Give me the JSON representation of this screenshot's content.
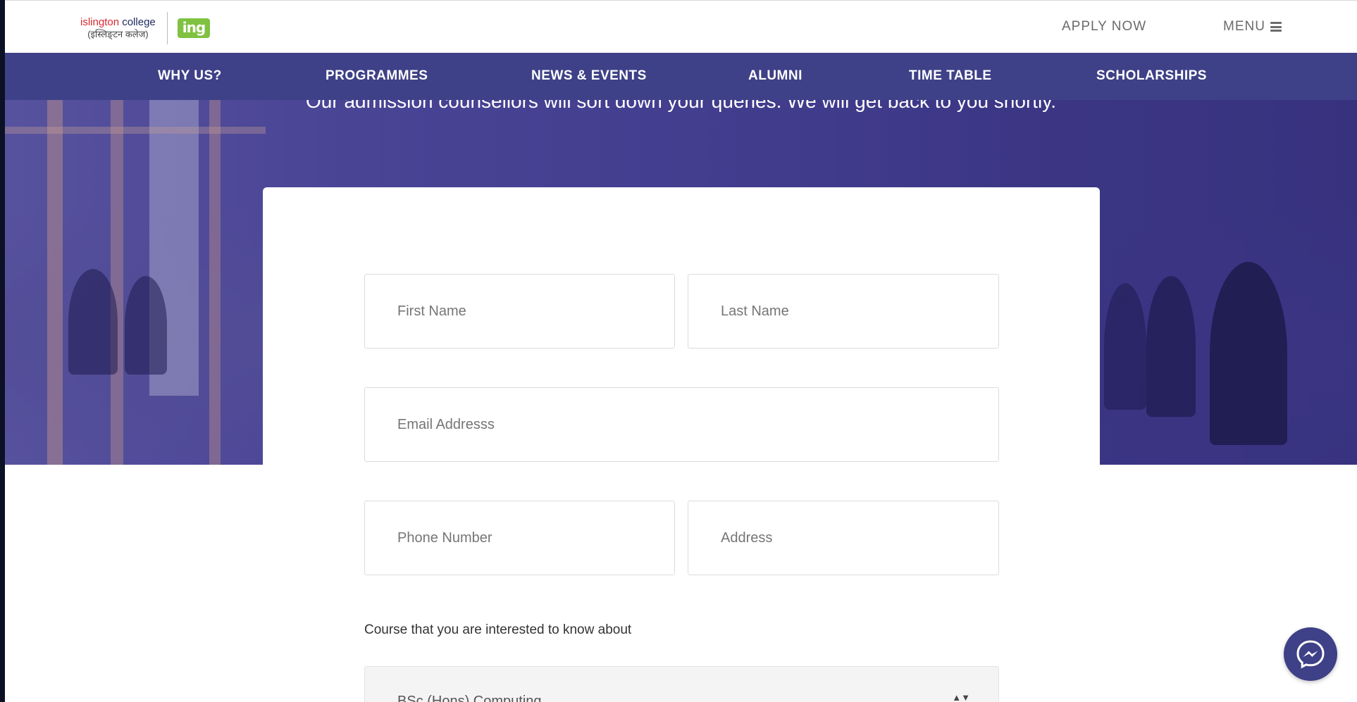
{
  "header": {
    "logo": {
      "name_prefix": "i",
      "name_main": "slington",
      "name_suffix": "college",
      "name_local": "(इस्लिङ्टन कलेज)",
      "badge": "ing"
    },
    "apply_label": "APPLY NOW",
    "menu_label": "MENU"
  },
  "nav": {
    "items": [
      {
        "label": "WHY US?"
      },
      {
        "label": "PROGRAMMES"
      },
      {
        "label": "NEWS & EVENTS"
      },
      {
        "label": "ALUMNI"
      },
      {
        "label": "TIME TABLE"
      },
      {
        "label": "SCHOLARSHIPS"
      }
    ]
  },
  "hero": {
    "subtitle": "Our admission counsellors will sort down your queries. We will get back to you shortly."
  },
  "form": {
    "first_name_placeholder": "First Name",
    "last_name_placeholder": "Last Name",
    "email_placeholder": "Email Addresss",
    "phone_placeholder": "Phone Number",
    "address_placeholder": "Address",
    "course_label": "Course that you are interested to know about",
    "course_selected": "BSc (Hons) Computing"
  },
  "colors": {
    "nav_bg": "#3e4187",
    "brand_red": "#d72a31",
    "brand_green": "#7fc241"
  },
  "icons": {
    "menu": "hamburger-icon",
    "messenger": "messenger-icon",
    "select": "updown-chevron-icon"
  }
}
